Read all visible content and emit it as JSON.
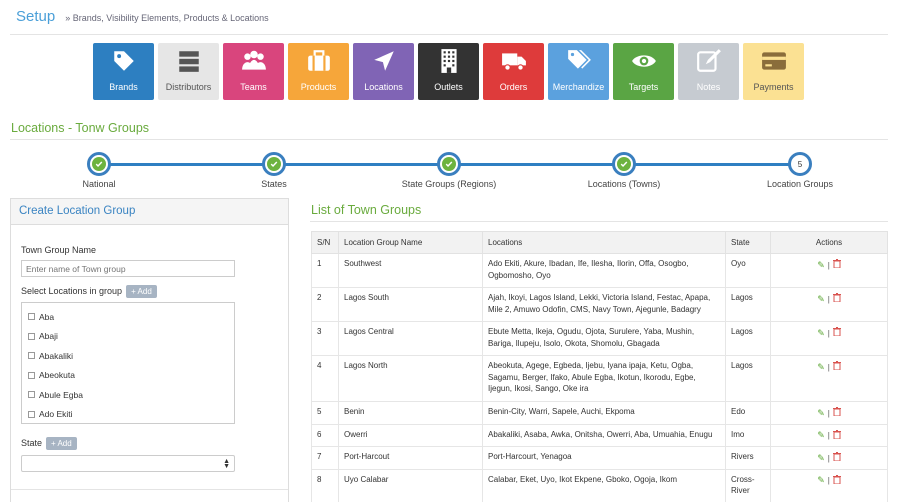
{
  "header": {
    "title": "Setup",
    "breadcrumb": "» Brands, Visibility Elements, Products & Locations"
  },
  "tiles": [
    {
      "label": "Brands",
      "icon": "tag-icon",
      "color": "#2d7fc1",
      "light": false
    },
    {
      "label": "Distributors",
      "icon": "server-icon",
      "color": "#e6e6e6",
      "light": true
    },
    {
      "label": "Teams",
      "icon": "users-icon",
      "color": "#d9457d",
      "light": false
    },
    {
      "label": "Products",
      "icon": "suitcase-icon",
      "color": "#f6a63a",
      "light": false
    },
    {
      "label": "Locations",
      "icon": "location-arrow-icon",
      "color": "#8064b5",
      "light": false
    },
    {
      "label": "Outlets",
      "icon": "building-icon",
      "color": "#333333",
      "light": false
    },
    {
      "label": "Orders",
      "icon": "truck-icon",
      "color": "#de3b3b",
      "light": false
    },
    {
      "label": "Merchandize",
      "icon": "tags-icon",
      "color": "#5ba1de",
      "light": false
    },
    {
      "label": "Targets",
      "icon": "eye-icon",
      "color": "#5aa544",
      "light": false
    },
    {
      "label": "Notes",
      "icon": "edit-icon",
      "color": "#c6cbd1",
      "light": false
    },
    {
      "label": "Payments",
      "icon": "credit-card-icon",
      "color": "#fbe193",
      "light": true
    }
  ],
  "section_title": "Locations - Tonw Groups",
  "steps": [
    {
      "label": "National",
      "done": true,
      "num": ""
    },
    {
      "label": "States",
      "done": true,
      "num": ""
    },
    {
      "label": "State Groups (Regions)",
      "done": true,
      "num": ""
    },
    {
      "label": "Locations (Towns)",
      "done": true,
      "num": ""
    },
    {
      "label": "Location Groups",
      "done": false,
      "num": "5"
    }
  ],
  "form": {
    "title": "Create Location Group",
    "name_label": "Town Group Name",
    "name_placeholder": "Enter name of Town group",
    "select_label": "Select Locations in group",
    "add_label": "+ Add",
    "locations": [
      "Aba",
      "Abaji",
      "Abakaliki",
      "Abeokuta",
      "Abule Egba",
      "Ado Ekiti"
    ],
    "state_label": "State",
    "state_value": ""
  },
  "list": {
    "title": "List of Town Groups",
    "columns": [
      "S/N",
      "Location Group Name",
      "Locations",
      "State",
      "Actions"
    ],
    "rows": [
      {
        "sn": "1",
        "name": "Southwest",
        "locations": "Ado Ekiti, Akure, Ibadan, Ife, Ilesha, Ilorin, Offa, Osogbo, Ogbomosho, Oyo",
        "state": "Oyo"
      },
      {
        "sn": "2",
        "name": "Lagos South",
        "locations": "Ajah, Ikoyi, Lagos Island, Lekki, Victoria Island, Festac, Apapa, Mile 2, Amuwo Odofin, CMS, Navy Town, Ajegunle, Badagry",
        "state": "Lagos"
      },
      {
        "sn": "3",
        "name": "Lagos Central",
        "locations": "Ebute Metta, Ikeja, Ogudu, Ojota, Surulere, Yaba, Mushin, Bariga, Ilupeju, Isolo, Okota, Shomolu, Gbagada",
        "state": "Lagos"
      },
      {
        "sn": "4",
        "name": "Lagos North",
        "locations": "Abeokuta, Agege, Egbeda, Ijebu, Iyana ipaja, Ketu, Ogba, Sagamu, Berger, Ifako, Abule Egba, Ikotun, Ikorodu, Egbe, Ijegun, Ikosi, Sango, Oke ira",
        "state": "Lagos"
      },
      {
        "sn": "5",
        "name": "Benin",
        "locations": "Benin-City, Warri, Sapele, Auchi, Ekpoma",
        "state": "Edo"
      },
      {
        "sn": "6",
        "name": "Owerri",
        "locations": "Abakaliki, Asaba, Awka, Onitsha, Owerri, Aba, Umuahia, Enugu",
        "state": "Imo"
      },
      {
        "sn": "7",
        "name": "Port-Harcout",
        "locations": "Port-Harcourt, Yenagoa",
        "state": "Rivers"
      },
      {
        "sn": "8",
        "name": "Uyo Calabar",
        "locations": "Calabar, Eket, Uyo, Ikot Ekpene, Gboko, Ogoja, Ikom",
        "state": "Cross-River"
      }
    ]
  }
}
